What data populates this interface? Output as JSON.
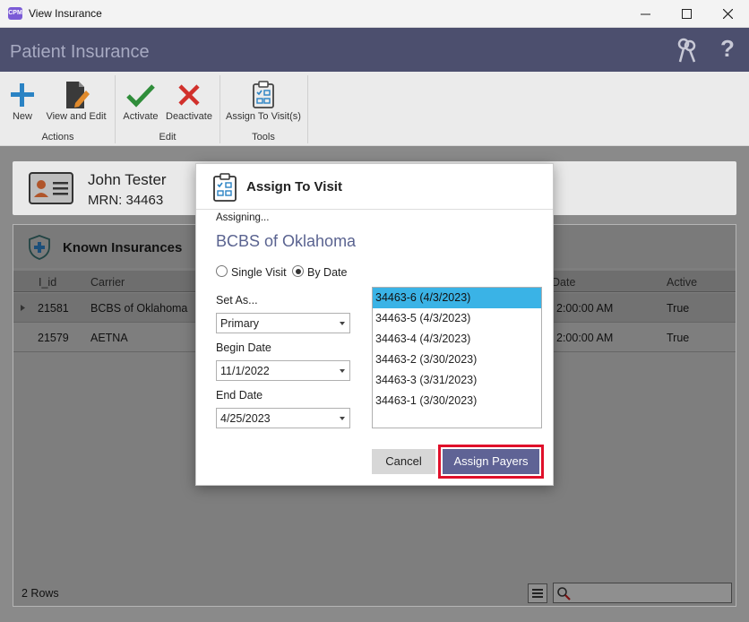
{
  "window": {
    "title": "View Insurance",
    "icon_text": "CPM",
    "controls": [
      "minimize-icon",
      "maximize-icon",
      "close-icon"
    ]
  },
  "header": {
    "title": "Patient Insurance",
    "icons": [
      "keys-icon",
      "help-icon"
    ]
  },
  "ribbon": {
    "groups": [
      {
        "label": "Actions",
        "buttons": [
          {
            "label": "New",
            "icon": "plus-icon"
          },
          {
            "label": "View and Edit",
            "icon": "edit-document-icon"
          }
        ]
      },
      {
        "label": "Edit",
        "buttons": [
          {
            "label": "Activate",
            "icon": "checkmark-icon"
          },
          {
            "label": "Deactivate",
            "icon": "x-mark-icon"
          }
        ]
      },
      {
        "label": "Tools",
        "buttons": [
          {
            "label": "Assign To Visit(s)",
            "icon": "clipboard-grid-icon"
          }
        ]
      }
    ]
  },
  "patient": {
    "name": "John Tester",
    "mrn": "MRN: 34463"
  },
  "known_insurances": {
    "title": "Known Insurances",
    "columns": [
      "I_id",
      "Carrier",
      "Date",
      "Active"
    ],
    "rows": [
      {
        "id": "21581",
        "carrier": "BCBS of Oklahoma",
        "date": "2:00:00 AM",
        "active": "True"
      },
      {
        "id": "21579",
        "carrier": "AETNA",
        "date": "2:00:00 AM",
        "active": "True"
      }
    ],
    "footer": "2 Rows"
  },
  "dialog": {
    "title": "Assign To Visit",
    "assigning_label": "Assigning...",
    "payer": "BCBS of Oklahoma",
    "radio_single": "Single Visit",
    "radio_by_date": "By Date",
    "selected_mode": "By Date",
    "set_as_label": "Set As...",
    "set_as_value": "Primary",
    "begin_label": "Begin Date",
    "begin_value": "11/1/2022",
    "end_label": "End Date",
    "end_value": "4/25/2023",
    "visits": [
      "34463-6 (4/3/2023)",
      "34463-5 (4/3/2023)",
      "34463-4 (4/3/2023)",
      "34463-2 (3/30/2023)",
      "34463-3 (3/31/2023)",
      "34463-1 (3/30/2023)"
    ],
    "selected_visit_index": 0,
    "cancel": "Cancel",
    "assign": "Assign Payers"
  },
  "colors": {
    "header_bg": "#4c4f6e",
    "accent_blue": "#5f6395",
    "selection": "#3ab3e6",
    "highlight": "#e0102a"
  }
}
